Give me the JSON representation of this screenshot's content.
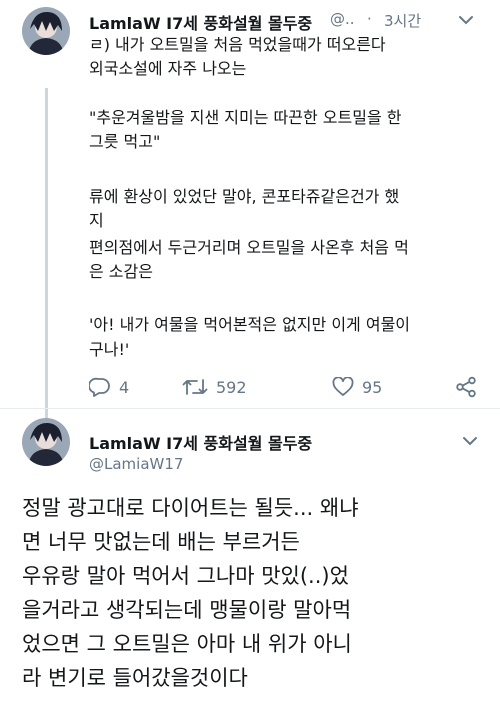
{
  "tweet1": {
    "display_name": "LamlaW I7세 풍화설월 몰두중",
    "handle": "@..",
    "separator": "·",
    "time": "3시간",
    "lines": [
      "ㄹ) 내가 오트밀을 처음 먹었을때가 떠오른다",
      "외국소설에 자주 나오는",
      "\"추운겨울밤을 지샌 지미는 따끈한 오트밀을 한",
      "그릇 먹고\"",
      "류에 환상이 있었단 말야, 콘포타쥬같은건가 했",
      "지",
      "편의점에서 두근거리며 오트밀을 사온후 처음 먹",
      "은 소감은",
      "'아! 내가 여물을 먹어본적은 없지만 이게 여물이",
      "구나!'"
    ],
    "actions": {
      "replies": "4",
      "retweets": "592",
      "likes": "95"
    }
  },
  "tweet2": {
    "display_name": "LamlaW I7세 풍화설월 몰두중",
    "handle": "@LamiaW17",
    "lines": [
      "정말 광고대로 다이어트는 될듯... 왜냐",
      "면 너무 맛없는데 배는 부르거든",
      "우유랑 말아 먹어서 그나마 맛있(..)었",
      "을거라고 생각되는데 맹물이랑 말아먹",
      "었으면 그 오트밀은 아마 내 위가 아니",
      "라 변기로 들어갔을것이다"
    ]
  },
  "colors": {
    "text": "#14171a",
    "secondary": "#657786",
    "line": "#ccd6dd",
    "divider": "#e6ecf0"
  }
}
